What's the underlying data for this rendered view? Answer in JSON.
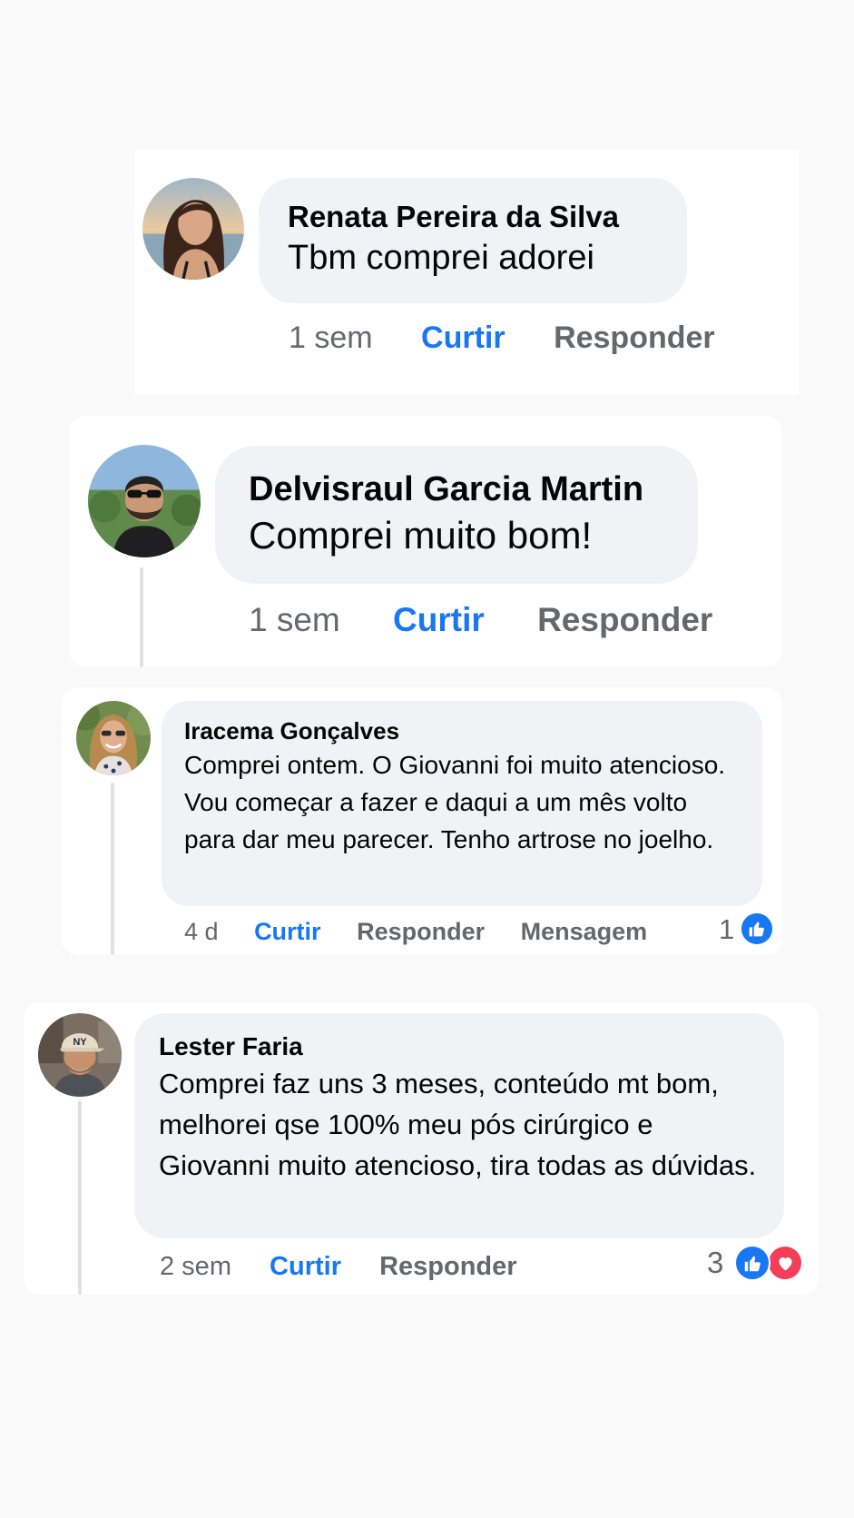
{
  "comments": [
    {
      "author": "Renata Pereira da Silva",
      "text": "Tbm comprei adorei",
      "time": "1 sem",
      "like_label": "Curtir",
      "reply_label": "Responder"
    },
    {
      "author": "Delvisraul Garcia Martin",
      "text": "Comprei muito bom!",
      "time": "1 sem",
      "like_label": "Curtir",
      "reply_label": "Responder"
    },
    {
      "author": "Iracema Gonçalves",
      "text": "Comprei ontem. O Giovanni foi muito atencioso. Vou começar a fazer e daqui a um mês volto para dar meu parecer.  Tenho artrose no joelho.",
      "time": "4 d",
      "like_label": "Curtir",
      "reply_label": "Responder",
      "message_label": "Mensagem",
      "reaction_count": "1",
      "reactions": [
        "like-icon"
      ]
    },
    {
      "author": "Lester Faria",
      "text": "Comprei faz uns 3 meses, conteúdo mt bom, melhorei qse 100% meu pós cirúrgico e Giovanni muito atencioso, tira todas as dúvidas.",
      "time": "2 sem",
      "like_label": "Curtir",
      "reply_label": "Responder",
      "reaction_count": "3",
      "reactions": [
        "like-icon",
        "love-icon"
      ]
    }
  ],
  "colors": {
    "like_blue": "#1877f2",
    "love_red": "#f33e58",
    "bubble_gray": "#f0f2f5",
    "muted_text": "#65676b"
  }
}
